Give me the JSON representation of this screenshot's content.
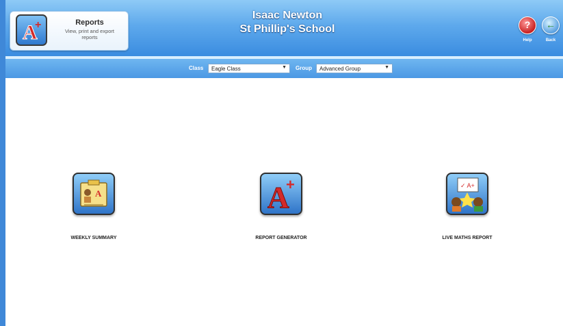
{
  "header": {
    "section_title": "Reports",
    "section_subtitle": "View, print and export reports",
    "user_name": "Isaac Newton",
    "school_name": "St Phillip's School",
    "help_label": "Help",
    "back_label": "Back",
    "help_glyph": "?",
    "back_glyph": "←"
  },
  "filters": {
    "class_label": "Class",
    "class_value": "Eagle Class",
    "group_label": "Group",
    "group_value": "Advanced Group"
  },
  "tiles": [
    {
      "label": "WEEKLY SUMMARY",
      "icon": "weekly-summary-icon"
    },
    {
      "label": "REPORT GENERATOR",
      "icon": "report-generator-icon"
    },
    {
      "label": "LIVE MATHS REPORT",
      "icon": "live-maths-report-icon"
    }
  ],
  "colors": {
    "header_blue": "#5ea9ec",
    "accent_red": "#d42a2a",
    "tile_blue": "#2f74c8"
  }
}
